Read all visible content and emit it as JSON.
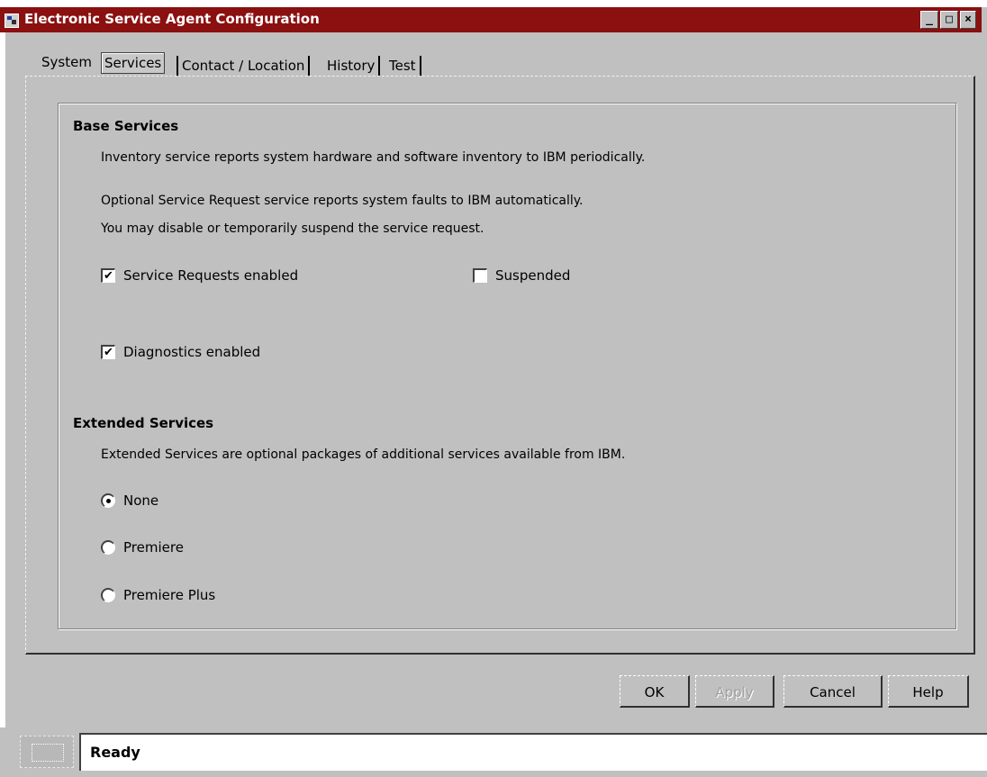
{
  "window": {
    "title": "Electronic Service Agent Configuration",
    "controls": {
      "minimize": "_",
      "maximize": "□",
      "close": "×"
    }
  },
  "tabs": [
    {
      "label": "System",
      "active": false
    },
    {
      "label": "Services",
      "active": true
    },
    {
      "label": "Contact / Location",
      "active": false
    },
    {
      "label": "History",
      "active": false
    },
    {
      "label": "Test",
      "active": false
    }
  ],
  "base_services": {
    "heading": "Base Services",
    "line1": "Inventory service reports system hardware and software inventory to IBM periodically.",
    "line2": "Optional Service Request service reports system faults to IBM automatically.",
    "line3": "You may disable or temporarily suspend the service request.",
    "service_requests": {
      "label": "Service Requests enabled",
      "checked": true
    },
    "suspended": {
      "label": "Suspended",
      "checked": false
    },
    "diagnostics": {
      "label": "Diagnostics enabled",
      "checked": true
    }
  },
  "extended_services": {
    "heading": "Extended Services",
    "description": "Extended Services are optional packages of additional services available from IBM.",
    "options": [
      {
        "label": "None",
        "selected": true
      },
      {
        "label": "Premiere",
        "selected": false
      },
      {
        "label": "Premiere Plus",
        "selected": false
      }
    ]
  },
  "buttons": {
    "ok": "OK",
    "apply": "Apply",
    "cancel": "Cancel",
    "help": "Help"
  },
  "status": {
    "text": "Ready"
  },
  "colors": {
    "titlebar": "#8b1010",
    "face": "#c0c0c0"
  }
}
